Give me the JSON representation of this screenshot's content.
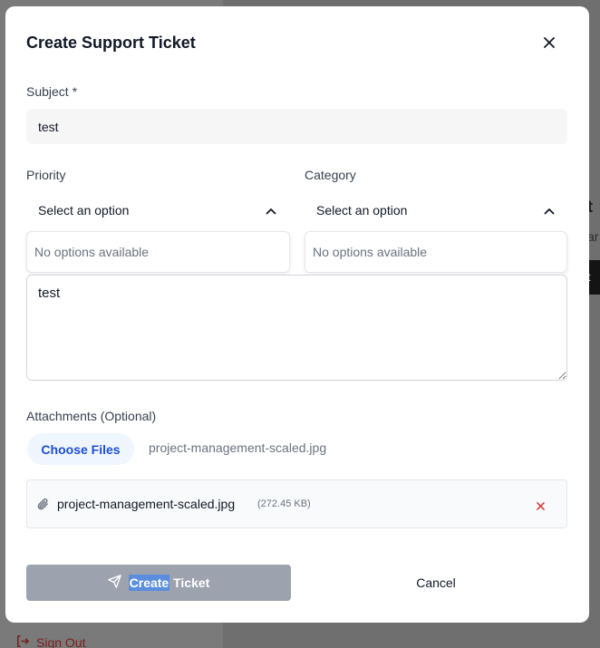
{
  "background": {
    "signout_label": "Sign Out",
    "fragment_title": "t",
    "fragment_sub": "ar",
    "fragment_btn": "t"
  },
  "modal": {
    "title": "Create Support Ticket",
    "subject": {
      "label": "Subject *",
      "value": "test"
    },
    "priority": {
      "label": "Priority",
      "selected": "Select an option",
      "empty_text": "No options available"
    },
    "category": {
      "label": "Category",
      "selected": "Select an option",
      "empty_text": "No options available"
    },
    "description": {
      "value": "test"
    },
    "attachments": {
      "label": "Attachments (Optional)",
      "choose_label": "Choose Files",
      "chosen_file": "project-management-scaled.jpg",
      "files": [
        {
          "name": "project-management-scaled.jpg",
          "size": "(272.45 KB)"
        }
      ]
    },
    "actions": {
      "create_label_part1": "Create",
      "create_label_part2": " Ticket",
      "cancel_label": "Cancel"
    }
  },
  "colors": {
    "primary_button_disabled": "#9ca3af",
    "choose_files_bg": "#eff6ff",
    "choose_files_text": "#1d4ed8",
    "remove_icon": "#dc2626",
    "signout": "#b91c1c"
  },
  "icons": {
    "close": "close-icon",
    "chevron": "chevron-up-icon",
    "paperclip": "paperclip-icon",
    "remove": "x-icon",
    "send": "send-icon",
    "signout": "sign-out-icon"
  }
}
